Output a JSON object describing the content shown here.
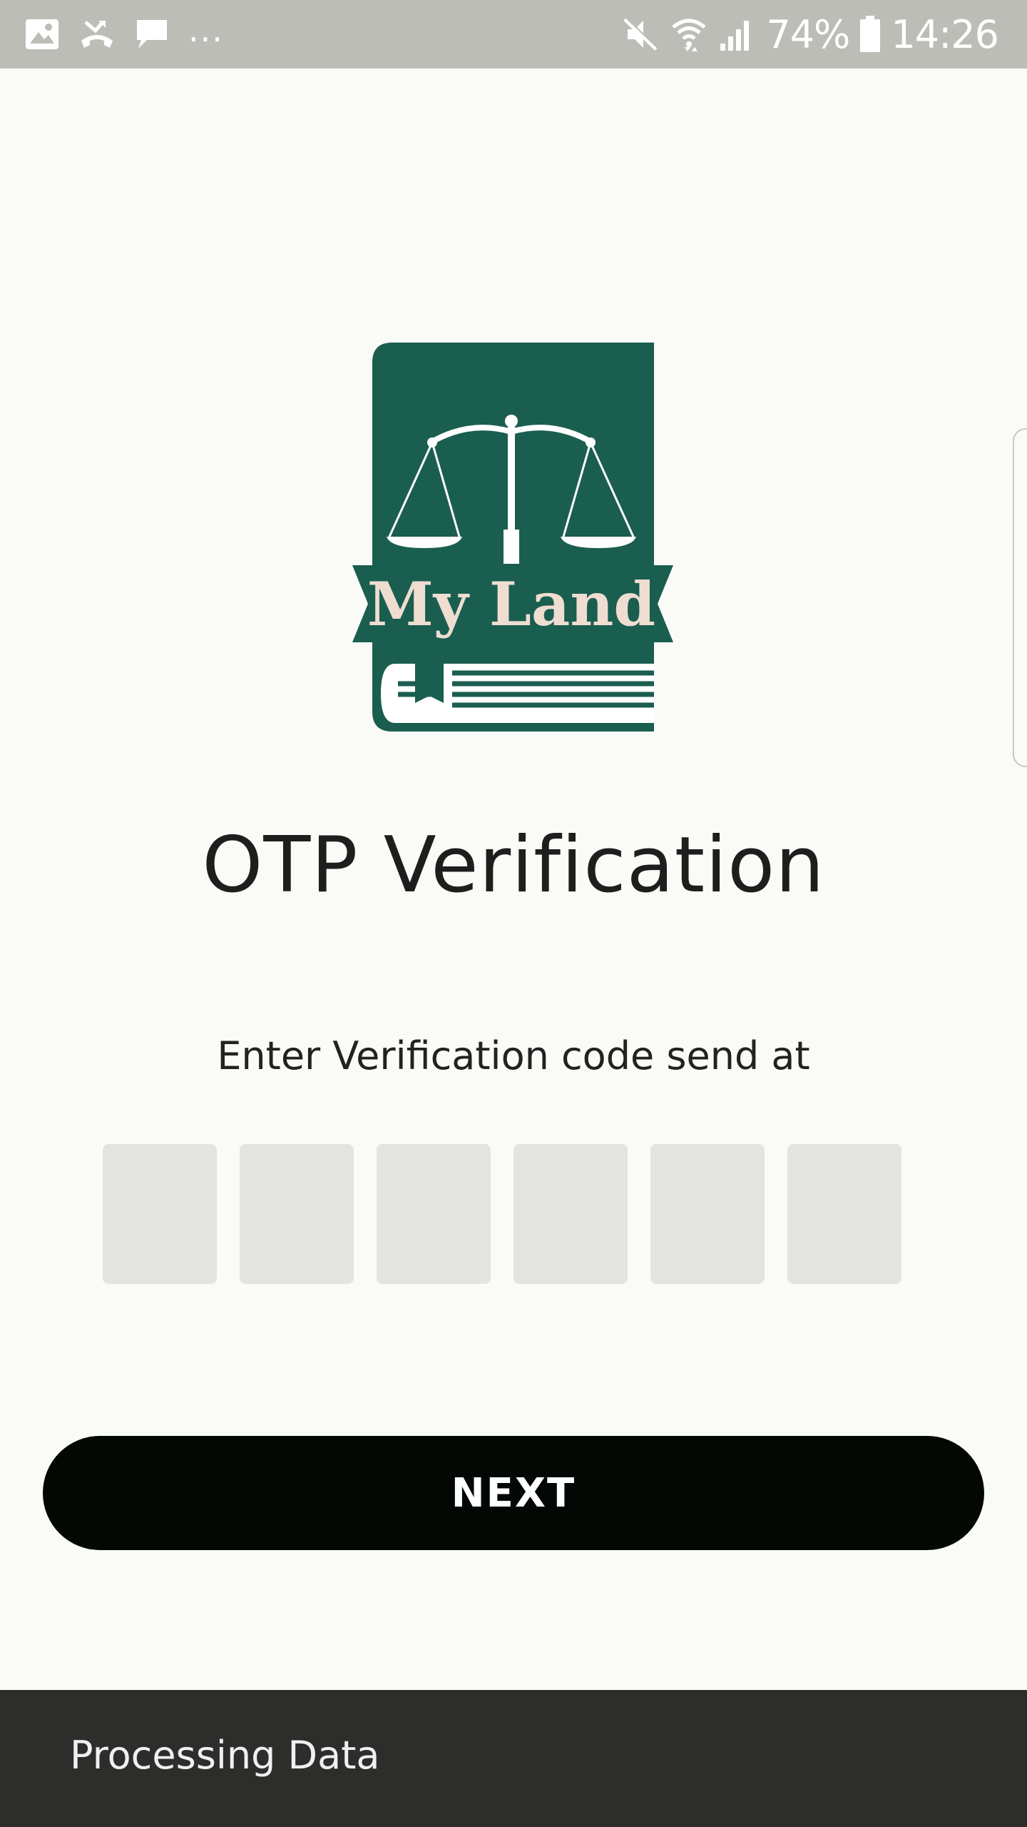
{
  "status_bar": {
    "icons_left": [
      "gallery-icon",
      "missed-call-icon",
      "message-icon"
    ],
    "more_indicator": "...",
    "icons_right": [
      "mute-icon",
      "wifi-icon",
      "signal-icon"
    ],
    "battery": "74%",
    "time": "14:26"
  },
  "logo": {
    "text": "My Land",
    "icon": "scales-of-justice-book-logo",
    "colors": {
      "book": "#1a5e50",
      "text": "#efddd1",
      "lines": "#ffffff"
    }
  },
  "main": {
    "title": "OTP Verification",
    "subtitle": "Enter Verification code send at",
    "otp_boxes": [
      {
        "value": ""
      },
      {
        "value": ""
      },
      {
        "value": ""
      },
      {
        "value": ""
      },
      {
        "value": ""
      },
      {
        "value": ""
      }
    ],
    "next_label": "NEXT"
  },
  "snackbar": {
    "message": "Processing Data"
  },
  "colors": {
    "background": "#fafaf6",
    "status_bar": "#bdbdb8",
    "button": "#030805",
    "otp_box": "#e3e3df",
    "snackbar": "#2d2e2b"
  }
}
